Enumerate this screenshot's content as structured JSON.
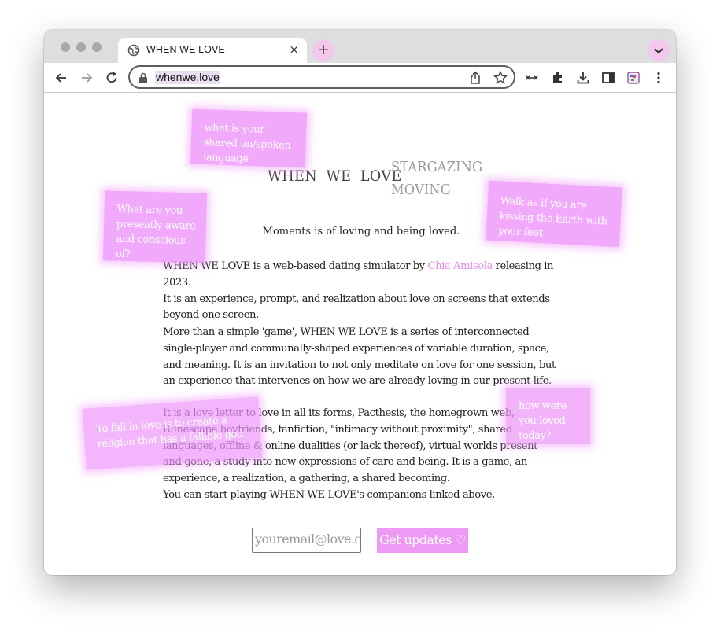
{
  "browser": {
    "tab_title": "WHEN WE LOVE",
    "tab_close": "×",
    "new_tab": "+",
    "url": "whenwe.love",
    "accent": "#f3c8ec"
  },
  "site": {
    "title": "WHEN  WE  LOVE",
    "nav": [
      "STARGAZING",
      "MOVING"
    ],
    "tagline": "Moments is of loving and being loved.",
    "intro_before": "WHEN WE LOVE is a web-based dating simulator by ",
    "author": "Chia Amisola",
    "intro_after": " releasing in 2023.",
    "intro_line2": "It is an experience, prompt, and realization about love on screens that extends beyond one screen.",
    "para2": "More than a simple 'game', WHEN WE LOVE is a series of interconnected single-player and communally-shaped experiences of variable duration, space, and meaning. It is an invitation to not only meditate on love for one session, but an experience that intervenes on how we are already loving in our present life.",
    "para3": "It is a love letter to love in all its forms, Pacthesis, the homegrown web, Runescape boyfriends, fanfiction, \"intimacy without proximity\", shared languages, offline & online dualities (or lack thereof), virtual worlds present and gone, a study into new expressions of care and being. It is a game, an experience, a realization, a gathering, a shared becoming.",
    "para4": "You can start playing WHEN WE LOVE's companions linked above.",
    "email_placeholder": "youremail@love.com",
    "button_label": "Get updates ♡",
    "link_color": "#e68fe7",
    "card_color": "#ee96fa"
  },
  "cards": [
    "what is your shared un/spoken language",
    "What are you presently aware and conscious of?",
    "Walk as if you are kissing the Earth with your feet",
    "To fall in love is to create a religion that has a fallible god",
    "how were you loved today?"
  ]
}
